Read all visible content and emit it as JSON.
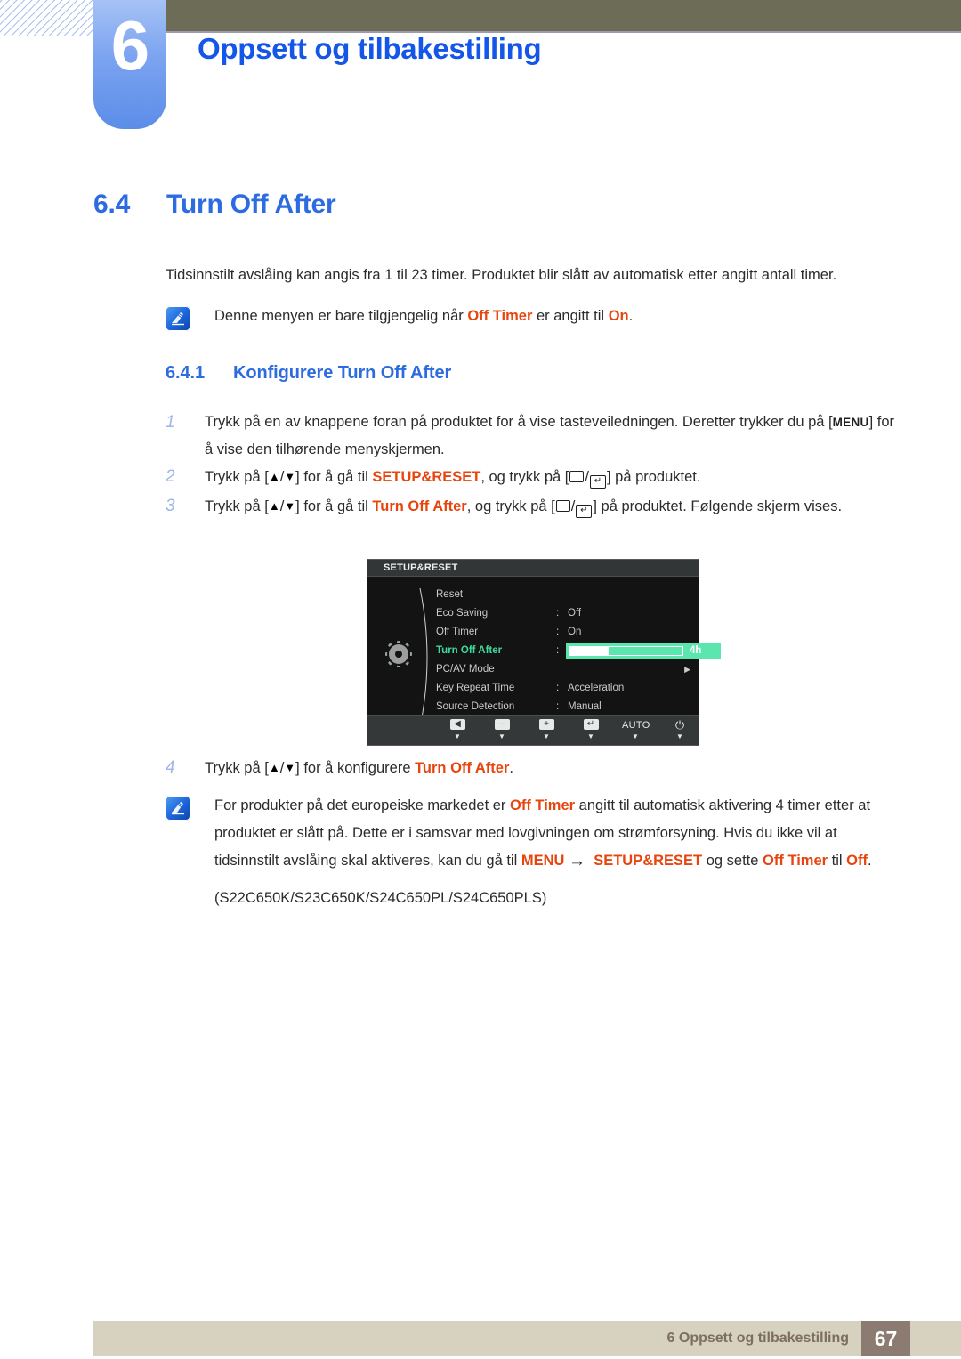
{
  "header": {
    "chapter_number": "6",
    "chapter_title": "Oppsett og tilbakestilling"
  },
  "section": {
    "number": "6.4",
    "title": "Turn Off After"
  },
  "intro_paragraph": "Tidsinnstilt avslåing kan angis fra 1 til 23 timer. Produktet blir slått av automatisk etter angitt antall timer.",
  "note_1": {
    "icon": "note-pen-icon",
    "text_before": "Denne menyen er bare tilgjengelig når ",
    "emphasis_1": "Off Timer",
    "text_middle": " er angitt til ",
    "emphasis_2": "On",
    "text_after": "."
  },
  "subsection": {
    "number": "6.4.1",
    "title": "Konfigurere Turn Off After"
  },
  "steps": [
    {
      "number": "1",
      "part_1": "Trykk på en av knappene foran på produktet for å vise tasteveiledningen. Deretter trykker du på [",
      "keycap": "MENU",
      "part_2": "] for å vise den tilhørende menyskjermen."
    },
    {
      "number": "2",
      "part_1": "Trykk på [",
      "up": "▲",
      "slash": "/",
      "down": "▼",
      "part_2": "] for å gå til ",
      "emphasis": "SETUP&RESET",
      "part_3": ", og trykk på [",
      "part_4": "] på produktet."
    },
    {
      "number": "3",
      "part_1": "Trykk på [",
      "up": "▲",
      "slash": "/",
      "down": "▼",
      "part_2": "] for å gå til ",
      "emphasis": "Turn Off After",
      "part_3": ", og trykk på [",
      "part_4": "] på produktet. Følgende skjerm vises."
    },
    {
      "number": "4",
      "part_1": "Trykk på [",
      "up": "▲",
      "slash": "/",
      "down": "▼",
      "part_2": "] for å konfigurere ",
      "emphasis": "Turn Off After",
      "part_3": "."
    }
  ],
  "osd": {
    "title": "SETUP&RESET",
    "gear_icon": "gear-icon",
    "rows": [
      {
        "label": "Reset",
        "colon": "",
        "value": ""
      },
      {
        "label": "Eco Saving",
        "colon": ":",
        "value": "Off"
      },
      {
        "label": "Off Timer",
        "colon": ":",
        "value": "On"
      },
      {
        "label": "Turn Off After",
        "colon": ":",
        "value": "4h",
        "active": true,
        "slider": true,
        "slider_fill_percent": 34
      },
      {
        "label": "PC/AV Mode",
        "colon": "",
        "value": "",
        "chevron": "▶"
      },
      {
        "label": "Key Repeat Time",
        "colon": ":",
        "value": "Acceleration"
      },
      {
        "label": "Source Detection",
        "colon": ":",
        "value": "Manual"
      }
    ],
    "scroll_down_arrow": "▼",
    "buttons": [
      {
        "name": "back-button",
        "glyph": "◀",
        "sub": "▼"
      },
      {
        "name": "minus-button",
        "glyph": "–",
        "sub": "▼"
      },
      {
        "name": "plus-button",
        "glyph": "+",
        "sub": "▼"
      },
      {
        "name": "enter-button",
        "glyph": "↵",
        "sub": "▼"
      },
      {
        "name": "auto-button",
        "glyph": "AUTO",
        "sub": "▼"
      },
      {
        "name": "power-button",
        "glyph": "⏻",
        "sub": "▼"
      }
    ]
  },
  "note_2": {
    "icon": "note-pen-icon",
    "part_1": "For produkter på det europeiske markedet er ",
    "emphasis_1": "Off Timer",
    "part_2": " angitt til automatisk aktivering 4 timer etter at produktet er slått på. Dette er i samsvar med lovgivningen om strømforsyning. Hvis du ikke vil at tidsinnstilt avslåing skal aktiveres, kan du gå til ",
    "emphasis_2": "MENU",
    "arrow": "→",
    "emphasis_3": "SETUP&RESET",
    "part_3": " og sette ",
    "emphasis_4": "Off Timer",
    "part_4": " til ",
    "emphasis_5": "Off",
    "part_5": ".",
    "models": "(S22C650K/S23C650K/S24C650PL/S24C650PLS)"
  },
  "footer": {
    "text": "6 Oppsett og tilbakestilling",
    "page": "67"
  },
  "colors": {
    "accent_blue": "#2d6ce0",
    "title_blue": "#1457e8",
    "emphasis_orange": "#e8450e",
    "olive": "#6d6c56",
    "footer_bg": "#d7d2bf",
    "footer_page_bg": "#8c7b70",
    "osd_highlight_green": "#3fd99a"
  }
}
